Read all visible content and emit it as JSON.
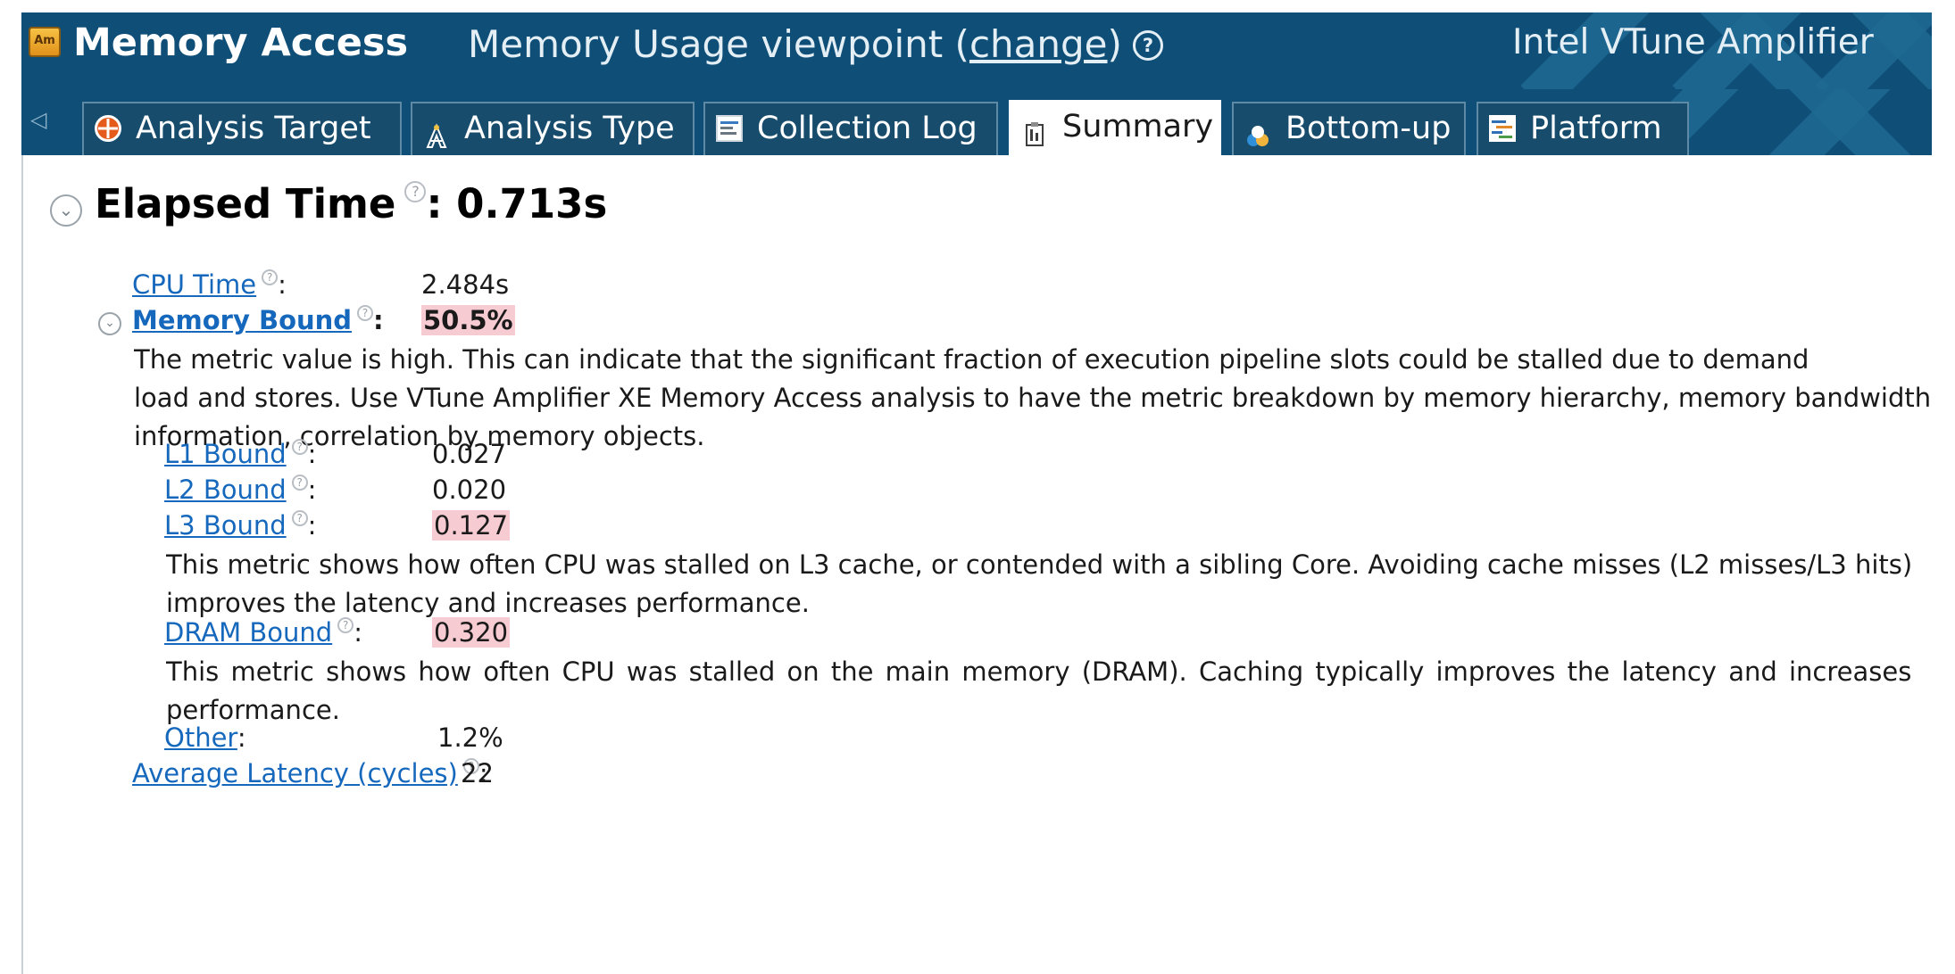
{
  "header": {
    "app_icon": "Am",
    "analysis_name": "Memory Access",
    "viewpoint_text": "Memory Usage viewpoint (",
    "change_link": "change",
    "viewpoint_close": ")",
    "help_icon": "help-icon",
    "product_name": "Intel VTune Amplifier"
  },
  "tabs": [
    {
      "label": "Analysis Target",
      "icon": "target-icon",
      "active": false
    },
    {
      "label": "Analysis Type",
      "icon": "analysis-type-icon",
      "active": false
    },
    {
      "label": "Collection Log",
      "icon": "log-icon",
      "active": false
    },
    {
      "label": "Summary",
      "icon": "summary-icon",
      "active": true
    },
    {
      "label": "Bottom-up",
      "icon": "bottom-up-icon",
      "active": false
    },
    {
      "label": "Platform",
      "icon": "platform-icon",
      "active": false
    }
  ],
  "summary": {
    "title_label": "Elapsed Time",
    "title_value": ": 0.713s",
    "cpu_time": {
      "label": "CPU Time",
      "colon": ":",
      "value": "2.484s"
    },
    "memory_bound": {
      "label": "Memory Bound",
      "colon": ":",
      "value": "50.5%",
      "description_lines": [
        "The metric value is high. This can indicate that the significant fraction of execution pipeline slots could be stalled due to demand",
        "load and stores. Use VTune Amplifier XE Memory Access analysis to have the metric breakdown by memory hierarchy, memory bandwidth",
        "information, correlation by memory objects."
      ]
    },
    "l1_bound": {
      "label": "L1 Bound",
      "colon": ":",
      "value": "0.027"
    },
    "l2_bound": {
      "label": "L2 Bound",
      "colon": ":",
      "value": "0.020"
    },
    "l3_bound": {
      "label": "L3 Bound",
      "colon": ":",
      "value": "0.127",
      "description_lines": [
        "This metric shows how often CPU was stalled on L3 cache, or contended with a sibling Core. Avoiding cache misses (L2 misses/L3 hits)",
        "improves the latency and increases performance."
      ]
    },
    "dram_bound": {
      "label": "DRAM Bound",
      "colon": ":",
      "value": "0.320",
      "description_lines": [
        "This metric shows how often CPU was stalled on the main memory (DRAM). Caching typically improves the latency and increases",
        "performance."
      ]
    },
    "other": {
      "label": "Other",
      "colon": ":",
      "value": "1.2%"
    },
    "average_latency": {
      "label": "Average Latency (cycles)",
      "colon": ":",
      "value": "22"
    }
  },
  "colors": {
    "header_bg": "#0f4f77",
    "link": "#1668bd",
    "highlight": "#f6cbd1"
  }
}
